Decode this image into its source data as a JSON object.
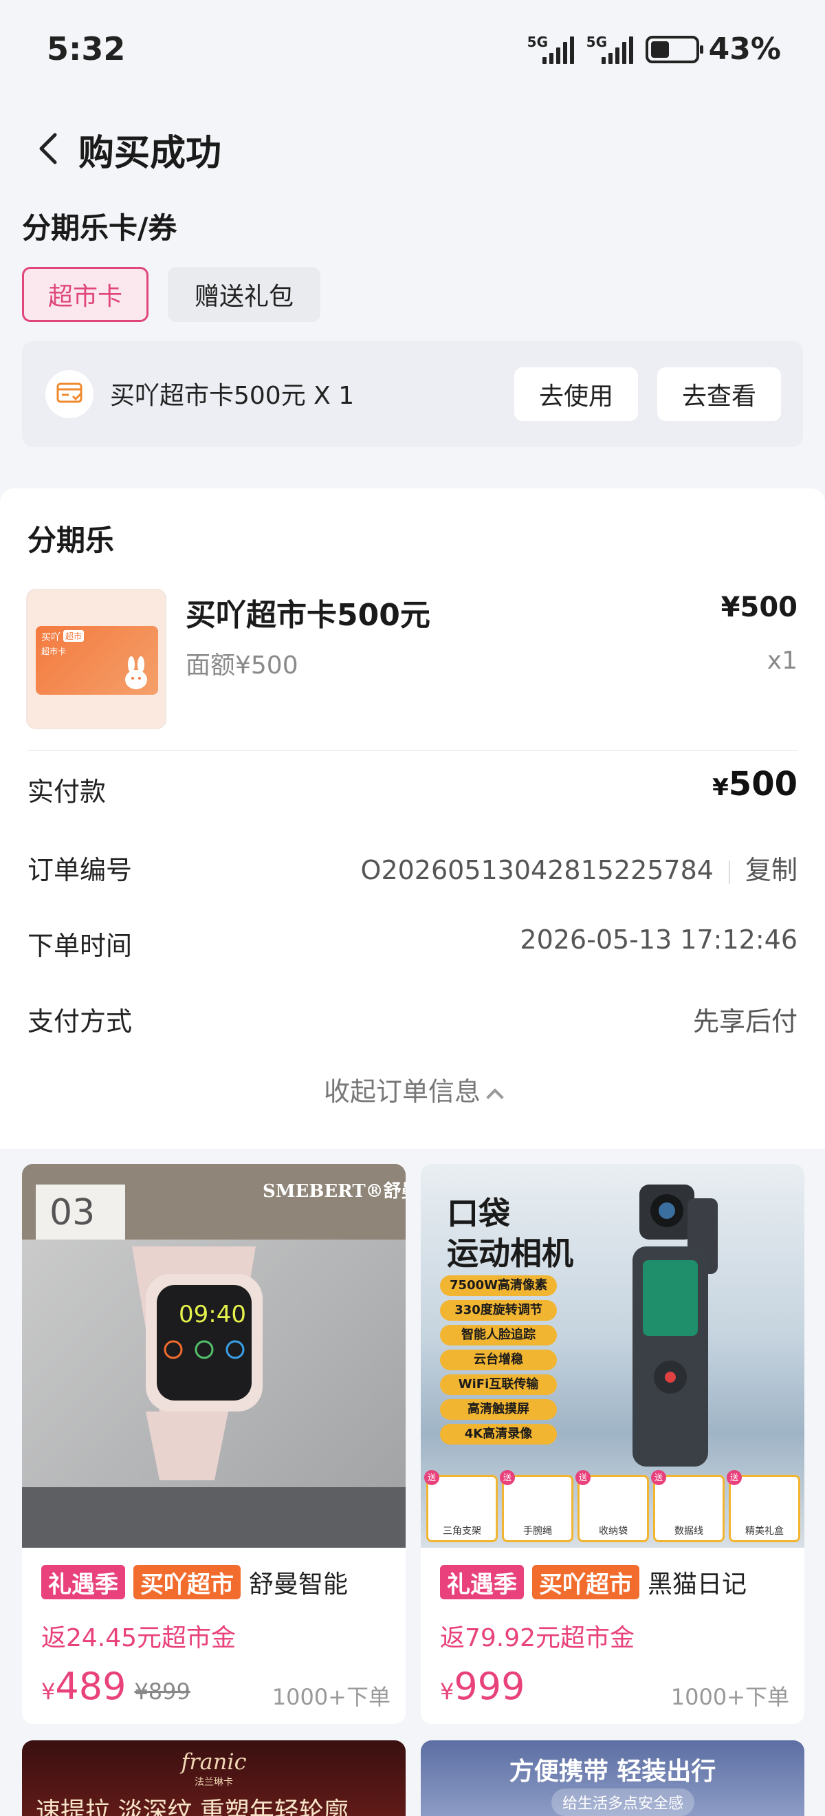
{
  "status_bar": {
    "time": "5:32",
    "net1": "5G",
    "net2": "5G",
    "battery": "43%",
    "battery_level": 0.43
  },
  "header": {
    "title": "购买成功"
  },
  "card_section": {
    "title": "分期乐卡/券",
    "tabs": [
      {
        "label": "超市卡",
        "active": true
      },
      {
        "label": "赠送礼包",
        "active": false
      }
    ],
    "card_item": {
      "label": "买吖超市卡500元 X 1",
      "use_btn": "去使用",
      "view_btn": "去查看"
    }
  },
  "order": {
    "title": "分期乐",
    "product": {
      "name": "买吖超市卡500元",
      "face": "面额¥500",
      "price": "¥500",
      "qty": "x1",
      "img_brand": "买吖",
      "img_tag": "超市",
      "img_sub": "超市卡"
    },
    "paid_label": "实付款",
    "paid_yen": "¥",
    "paid_value": "500",
    "order_no_label": "订单编号",
    "order_no": "O202605130428152257​84",
    "copy": "复制",
    "time_label": "下单时间",
    "time": "2026-05-13 17:12:46",
    "method_label": "支付方式",
    "method": "先享后付",
    "collapse": "收起订单信息"
  },
  "products": [
    {
      "img_brand": "SMEBERT®舒曼",
      "img_num": "03",
      "watch_time": "09:40",
      "tag1": "礼遇季",
      "tag2": "买吖超市",
      "title": "舒曼智能",
      "cash": "返24.45元超市金",
      "yen": "¥",
      "price": "489",
      "orig": "¥899",
      "sold": "1000+下单"
    },
    {
      "img_title1": "口袋",
      "img_title2": "运动相机",
      "features": [
        "7500W高清像素",
        "330度旋转调节",
        "智能人脸追踪",
        "云台增稳",
        "WiFi互联传输",
        "高清触摸屏",
        "4K高清录像"
      ],
      "gifts": [
        "三角支架",
        "手腕绳",
        "收纳袋",
        "数据线",
        "精美礼盒"
      ],
      "gift_badge": "送",
      "tag1": "礼遇季",
      "tag2": "买吖超市",
      "title": "黑猫日记",
      "cash": "返79.92元超市金",
      "yen": "¥",
      "price": "999",
      "sold": "1000+下单"
    },
    {
      "img_brand": "franic",
      "img_sub": "法兰琳卡",
      "img_text": "速提拉 淡深纹 重塑年轻轮廓"
    },
    {
      "img_text": "方便携带 轻装出行",
      "img_sub": "给生活多点安全感"
    }
  ]
}
